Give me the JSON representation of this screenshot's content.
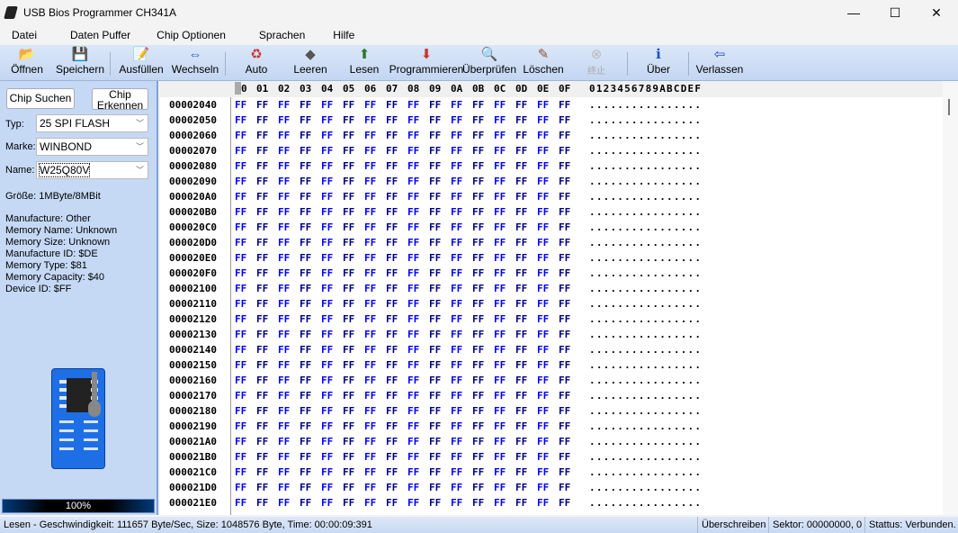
{
  "window": {
    "title": "USB Bios Programmer CH341A",
    "minimize": "—",
    "maximize": "☐",
    "close": "✕"
  },
  "menu": [
    "Datei",
    "Daten Puffer",
    "Chip Optionen",
    "Sprachen",
    "Hilfe"
  ],
  "toolbar": [
    {
      "label": "Öffnen",
      "icon": "📂"
    },
    {
      "label": "Speichern",
      "icon": "💾"
    },
    {
      "label": "Ausfüllen",
      "icon": "📝"
    },
    {
      "label": "Wechseln",
      "icon": "⇔"
    },
    {
      "label": "Auto",
      "icon": "♻"
    },
    {
      "label": "Leeren",
      "icon": "◆"
    },
    {
      "label": "Lesen",
      "icon": "⬆"
    },
    {
      "label": "Programmieren",
      "icon": "⬇"
    },
    {
      "label": "Überprüfen",
      "icon": "🔍"
    },
    {
      "label": "Löschen",
      "icon": "✎"
    },
    {
      "label": "终止",
      "icon": "⊗"
    },
    {
      "label": "Über",
      "icon": "ℹ"
    },
    {
      "label": "Verlassen",
      "icon": "⇦"
    }
  ],
  "left": {
    "chip_suchen": "Chip Suchen",
    "chip_erkennen": "Chip Erkennen",
    "typ_label": "Typ:",
    "typ": "25 SPI FLASH",
    "marke_label": "Marke:",
    "marke": "WINBOND",
    "name_label": "Name:",
    "name": "W25Q80V",
    "groesse": "Größe: 1MByte/8MBit",
    "info": [
      "Manufacture: Other",
      "Memory Name: Unknown",
      "Memory Size: Unknown",
      "Manufacture ID: $DE",
      "Memory Type: $81",
      "Memory Capacity: $40",
      "Device ID: $FF"
    ],
    "progress_percent": 100,
    "progress_label": "100%"
  },
  "hex": {
    "columns": [
      "0",
      "01",
      "02",
      "03",
      "04",
      "05",
      "06",
      "07",
      "08",
      "09",
      "0A",
      "0B",
      "0C",
      "0D",
      "0E",
      "0F"
    ],
    "ascii_header": "0123456789ABCDEF",
    "rows": [
      {
        "addr": "00002040",
        "bytes": [
          "FF",
          "FF",
          "FF",
          "FF",
          "FF",
          "FF",
          "FF",
          "FF",
          "FF",
          "FF",
          "FF",
          "FF",
          "FF",
          "FF",
          "FF",
          "FF"
        ],
        "ascii": "................"
      },
      {
        "addr": "00002050",
        "bytes": [
          "FF",
          "FF",
          "FF",
          "FF",
          "FF",
          "FF",
          "FF",
          "FF",
          "FF",
          "FF",
          "FF",
          "FF",
          "FF",
          "FF",
          "FF",
          "FF"
        ],
        "ascii": "................"
      },
      {
        "addr": "00002060",
        "bytes": [
          "FF",
          "FF",
          "FF",
          "FF",
          "FF",
          "FF",
          "FF",
          "FF",
          "FF",
          "FF",
          "FF",
          "FF",
          "FF",
          "FF",
          "FF",
          "FF"
        ],
        "ascii": "................"
      },
      {
        "addr": "00002070",
        "bytes": [
          "FF",
          "FF",
          "FF",
          "FF",
          "FF",
          "FF",
          "FF",
          "FF",
          "FF",
          "FF",
          "FF",
          "FF",
          "FF",
          "FF",
          "FF",
          "FF"
        ],
        "ascii": "................"
      },
      {
        "addr": "00002080",
        "bytes": [
          "FF",
          "FF",
          "FF",
          "FF",
          "FF",
          "FF",
          "FF",
          "FF",
          "FF",
          "FF",
          "FF",
          "FF",
          "FF",
          "FF",
          "FF",
          "FF"
        ],
        "ascii": "................"
      },
      {
        "addr": "00002090",
        "bytes": [
          "FF",
          "FF",
          "FF",
          "FF",
          "FF",
          "FF",
          "FF",
          "FF",
          "FF",
          "FF",
          "FF",
          "FF",
          "FF",
          "FF",
          "FF",
          "FF"
        ],
        "ascii": "................"
      },
      {
        "addr": "000020A0",
        "bytes": [
          "FF",
          "FF",
          "FF",
          "FF",
          "FF",
          "FF",
          "FF",
          "FF",
          "FF",
          "FF",
          "FF",
          "FF",
          "FF",
          "FF",
          "FF",
          "FF"
        ],
        "ascii": "................"
      },
      {
        "addr": "000020B0",
        "bytes": [
          "FF",
          "FF",
          "FF",
          "FF",
          "FF",
          "FF",
          "FF",
          "FF",
          "FF",
          "FF",
          "FF",
          "FF",
          "FF",
          "FF",
          "FF",
          "FF"
        ],
        "ascii": "................"
      },
      {
        "addr": "000020C0",
        "bytes": [
          "FF",
          "FF",
          "FF",
          "FF",
          "FF",
          "FF",
          "FF",
          "FF",
          "FF",
          "FF",
          "FF",
          "FF",
          "FF",
          "FF",
          "FF",
          "FF"
        ],
        "ascii": "................"
      },
      {
        "addr": "000020D0",
        "bytes": [
          "FF",
          "FF",
          "FF",
          "FF",
          "FF",
          "FF",
          "FF",
          "FF",
          "FF",
          "FF",
          "FF",
          "FF",
          "FF",
          "FF",
          "FF",
          "FF"
        ],
        "ascii": "................"
      },
      {
        "addr": "000020E0",
        "bytes": [
          "FF",
          "FF",
          "FF",
          "FF",
          "FF",
          "FF",
          "FF",
          "FF",
          "FF",
          "FF",
          "FF",
          "FF",
          "FF",
          "FF",
          "FF",
          "FF"
        ],
        "ascii": "................"
      },
      {
        "addr": "000020F0",
        "bytes": [
          "FF",
          "FF",
          "FF",
          "FF",
          "FF",
          "FF",
          "FF",
          "FF",
          "FF",
          "FF",
          "FF",
          "FF",
          "FF",
          "FF",
          "FF",
          "FF"
        ],
        "ascii": "................"
      },
      {
        "addr": "00002100",
        "bytes": [
          "FF",
          "FF",
          "FF",
          "FF",
          "FF",
          "FF",
          "FF",
          "FF",
          "FF",
          "FF",
          "FF",
          "FF",
          "FF",
          "FF",
          "FF",
          "FF"
        ],
        "ascii": "................"
      },
      {
        "addr": "00002110",
        "bytes": [
          "FF",
          "FF",
          "FF",
          "FF",
          "FF",
          "FF",
          "FF",
          "FF",
          "FF",
          "FF",
          "FF",
          "FF",
          "FF",
          "FF",
          "FF",
          "FF"
        ],
        "ascii": "................"
      },
      {
        "addr": "00002120",
        "bytes": [
          "FF",
          "FF",
          "FF",
          "FF",
          "FF",
          "FF",
          "FF",
          "FF",
          "FF",
          "FF",
          "FF",
          "FF",
          "FF",
          "FF",
          "FF",
          "FF"
        ],
        "ascii": "................"
      },
      {
        "addr": "00002130",
        "bytes": [
          "FF",
          "FF",
          "FF",
          "FF",
          "FF",
          "FF",
          "FF",
          "FF",
          "FF",
          "FF",
          "FF",
          "FF",
          "FF",
          "FF",
          "FF",
          "FF"
        ],
        "ascii": "................"
      },
      {
        "addr": "00002140",
        "bytes": [
          "FF",
          "FF",
          "FF",
          "FF",
          "FF",
          "FF",
          "FF",
          "FF",
          "FF",
          "FF",
          "FF",
          "FF",
          "FF",
          "FF",
          "FF",
          "FF"
        ],
        "ascii": "................"
      },
      {
        "addr": "00002150",
        "bytes": [
          "FF",
          "FF",
          "FF",
          "FF",
          "FF",
          "FF",
          "FF",
          "FF",
          "FF",
          "FF",
          "FF",
          "FF",
          "FF",
          "FF",
          "FF",
          "FF"
        ],
        "ascii": "................"
      },
      {
        "addr": "00002160",
        "bytes": [
          "FF",
          "FF",
          "FF",
          "FF",
          "FF",
          "FF",
          "FF",
          "FF",
          "FF",
          "FF",
          "FF",
          "FF",
          "FF",
          "FF",
          "FF",
          "FF"
        ],
        "ascii": "................"
      },
      {
        "addr": "00002170",
        "bytes": [
          "FF",
          "FF",
          "FF",
          "FF",
          "FF",
          "FF",
          "FF",
          "FF",
          "FF",
          "FF",
          "FF",
          "FF",
          "FF",
          "FF",
          "FF",
          "FF"
        ],
        "ascii": "................"
      },
      {
        "addr": "00002180",
        "bytes": [
          "FF",
          "FF",
          "FF",
          "FF",
          "FF",
          "FF",
          "FF",
          "FF",
          "FF",
          "FF",
          "FF",
          "FF",
          "FF",
          "FF",
          "FF",
          "FF"
        ],
        "ascii": "................"
      },
      {
        "addr": "00002190",
        "bytes": [
          "FF",
          "FF",
          "FF",
          "FF",
          "FF",
          "FF",
          "FF",
          "FF",
          "FF",
          "FF",
          "FF",
          "FF",
          "FF",
          "FF",
          "FF",
          "FF"
        ],
        "ascii": "................"
      },
      {
        "addr": "000021A0",
        "bytes": [
          "FF",
          "FF",
          "FF",
          "FF",
          "FF",
          "FF",
          "FF",
          "FF",
          "FF",
          "FF",
          "FF",
          "FF",
          "FF",
          "FF",
          "FF",
          "FF"
        ],
        "ascii": "................"
      },
      {
        "addr": "000021B0",
        "bytes": [
          "FF",
          "FF",
          "FF",
          "FF",
          "FF",
          "FF",
          "FF",
          "FF",
          "FF",
          "FF",
          "FF",
          "FF",
          "FF",
          "FF",
          "FF",
          "FF"
        ],
        "ascii": "................"
      },
      {
        "addr": "000021C0",
        "bytes": [
          "FF",
          "FF",
          "FF",
          "FF",
          "FF",
          "FF",
          "FF",
          "FF",
          "FF",
          "FF",
          "FF",
          "FF",
          "FF",
          "FF",
          "FF",
          "FF"
        ],
        "ascii": "................"
      },
      {
        "addr": "000021D0",
        "bytes": [
          "FF",
          "FF",
          "FF",
          "FF",
          "FF",
          "FF",
          "FF",
          "FF",
          "FF",
          "FF",
          "FF",
          "FF",
          "FF",
          "FF",
          "FF",
          "FF"
        ],
        "ascii": "................"
      },
      {
        "addr": "000021E0",
        "bytes": [
          "FF",
          "FF",
          "FF",
          "FF",
          "FF",
          "FF",
          "FF",
          "FF",
          "FF",
          "FF",
          "FF",
          "FF",
          "FF",
          "FF",
          "FF",
          "FF"
        ],
        "ascii": "................"
      }
    ]
  },
  "status": {
    "message": "Lesen - Geschwindigkeit: 111657 Byte/Sec, Size: 1048576 Byte, Time: 00:00:09:391",
    "mode": "Überschreiben",
    "sektor": "Sektor: 00000000, 0",
    "status": "Stattus: Verbunden."
  }
}
